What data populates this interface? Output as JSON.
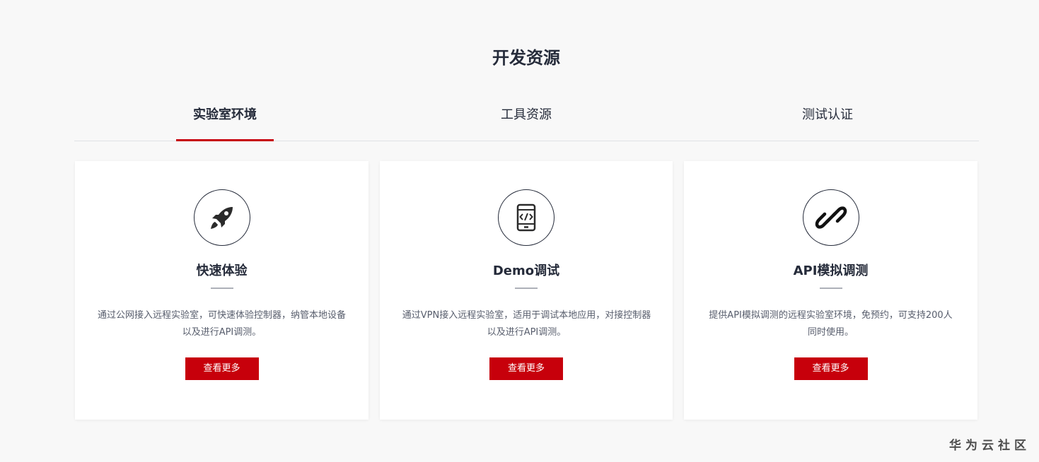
{
  "section": {
    "title": "开发资源"
  },
  "tabs": [
    {
      "label": "实验室环境",
      "active": true
    },
    {
      "label": "工具资源",
      "active": false
    },
    {
      "label": "测试认证",
      "active": false
    }
  ],
  "cards": [
    {
      "icon": "rocket-icon",
      "title": "快速体验",
      "description": "通过公网接入远程实验室，可快速体验控制器，纳管本地设备以及进行API调测。",
      "button": "查看更多"
    },
    {
      "icon": "code-device-icon",
      "title": "Demo调试",
      "description": "通过VPN接入远程实验室，适用于调试本地应用，对接控制器以及进行API调测。",
      "button": "查看更多"
    },
    {
      "icon": "link-icon",
      "title": "API模拟调测",
      "description": "提供API模拟调测的远程实验室环境，免预约，可支持200人同时使用。",
      "button": "查看更多"
    }
  ],
  "watermark": "华为云社区",
  "colors": {
    "accent": "#c7000b",
    "background": "#f8f8f8",
    "text": "#252b3a"
  }
}
